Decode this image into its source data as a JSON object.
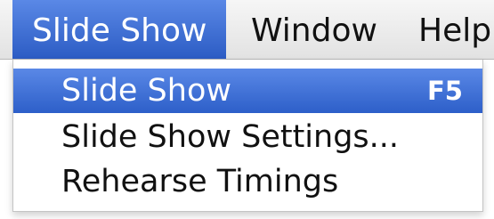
{
  "menubar": {
    "menus": [
      {
        "label": "Slide Show"
      },
      {
        "label": "Window"
      },
      {
        "label": "Help"
      }
    ]
  },
  "dropdown": {
    "items": [
      {
        "label": "Slide Show",
        "shortcut": "F5"
      },
      {
        "label": "Slide Show Settings..."
      },
      {
        "label": "Rehearse Timings"
      }
    ]
  },
  "colors": {
    "highlight": "#3a6cd4",
    "menubar_bg": "#ececec",
    "text": "#111111"
  }
}
